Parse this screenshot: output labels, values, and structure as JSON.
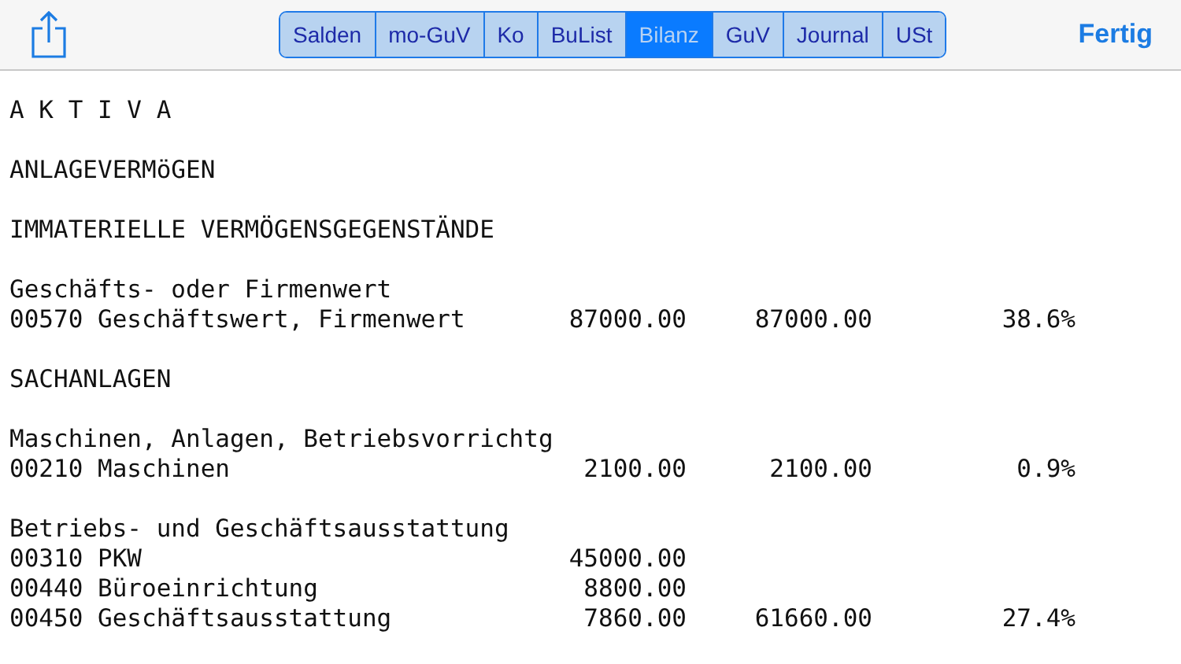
{
  "toolbar": {
    "segments": [
      {
        "label": "Salden",
        "selected": false
      },
      {
        "label": "mo-GuV",
        "selected": false
      },
      {
        "label": "Ko",
        "selected": false
      },
      {
        "label": "BuList",
        "selected": false
      },
      {
        "label": "Bilanz",
        "selected": true
      },
      {
        "label": "GuV",
        "selected": false
      },
      {
        "label": "Journal",
        "selected": false
      },
      {
        "label": "USt",
        "selected": false
      }
    ],
    "done_button": "Fertig"
  },
  "report": {
    "blocks": [
      [
        {
          "kind": "heading",
          "text": "A K T I V A"
        }
      ],
      [
        {
          "kind": "heading",
          "text": "ANLAGEVERMöGEN"
        }
      ],
      [
        {
          "kind": "heading",
          "text": "IMMATERIELLE VERMÖGENSGEGENSTÄNDE"
        }
      ],
      [
        {
          "kind": "heading",
          "text": "Geschäfts- oder Firmenwert"
        },
        {
          "kind": "entry",
          "account": "00570 Geschäftswert, Firmenwert",
          "amount": "87000.00",
          "total": "87000.00",
          "share": "38.6%"
        }
      ],
      [
        {
          "kind": "heading",
          "text": "SACHANLAGEN"
        }
      ],
      [
        {
          "kind": "heading",
          "text": "Maschinen, Anlagen, Betriebsvorrichtg"
        },
        {
          "kind": "entry",
          "account": "00210 Maschinen",
          "amount": "2100.00",
          "total": "2100.00",
          "share": "0.9%"
        }
      ],
      [
        {
          "kind": "heading",
          "text": "Betriebs- und Geschäftsausstattung"
        },
        {
          "kind": "entry",
          "account": "00310 PKW",
          "amount": "45000.00"
        },
        {
          "kind": "entry",
          "account": "00440 Büroeinrichtung",
          "amount": "8800.00"
        },
        {
          "kind": "entry",
          "account": "00450 Geschäftsausstattung",
          "amount": "7860.00",
          "total": "61660.00",
          "share": "27.4%"
        }
      ]
    ]
  }
}
